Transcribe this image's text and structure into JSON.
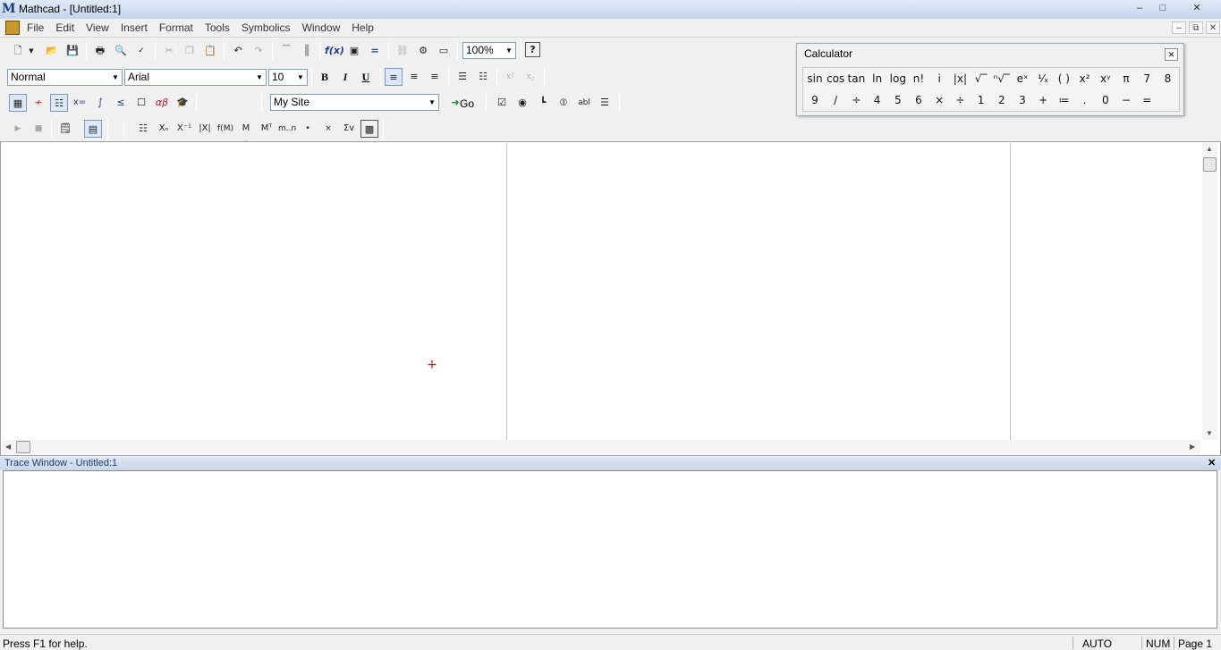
{
  "app": {
    "title": "Mathcad - [Untitled:1]",
    "logo_letter": "M"
  },
  "window_buttons": [
    "–",
    "□",
    "✕"
  ],
  "mdi_buttons": [
    "–",
    "⧉",
    "✕"
  ],
  "menu": {
    "items": [
      "File",
      "Edit",
      "View",
      "Insert",
      "Format",
      "Tools",
      "Symbolics",
      "Window",
      "Help"
    ]
  },
  "standard_toolbar": {
    "zoom": "100%"
  },
  "formatting_toolbar": {
    "style": "Normal",
    "font": "Arial",
    "size": "10",
    "bold": "B",
    "italic": "I",
    "underline": "U",
    "superscript": "x²",
    "subscript": "x₂"
  },
  "resources_toolbar": {
    "site": "My Site",
    "go_label": "Go"
  },
  "calculator": {
    "title": "Calculator",
    "close": "✕",
    "keys_row1": [
      "sin",
      "cos",
      "tan",
      "ln",
      "log",
      "n!",
      "i",
      "|x|",
      "√‾",
      "ⁿ√‾",
      "eˣ",
      "¹⁄ₓ",
      "( )",
      "x²",
      "xʸ",
      "π",
      "7",
      "8"
    ],
    "keys_row2": [
      "9",
      "/",
      "÷",
      "4",
      "5",
      "6",
      "×",
      "÷",
      "1",
      "2",
      "3",
      "+",
      "≔",
      ".",
      "0",
      "−",
      "="
    ]
  },
  "trace_window": {
    "title": "Trace Window - Untitled:1",
    "close": "✕"
  },
  "status": {
    "help": "Press F1 for help.",
    "calc_mode": "AUTO",
    "num_lock": "NUM",
    "page": "Page 1"
  },
  "colors": {
    "title_gradient_top": "#dfe9f5",
    "crosshair": "#d00000",
    "trace_header": "#c8d6e9"
  }
}
